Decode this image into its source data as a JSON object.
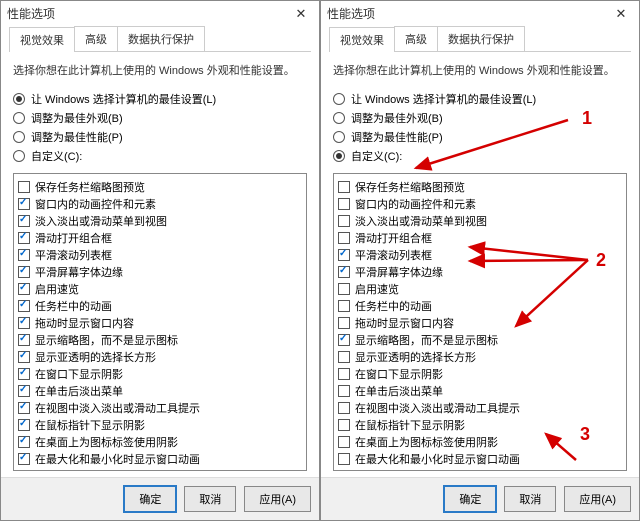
{
  "dialog_title": "性能选项",
  "tabs": {
    "visual": "视觉效果",
    "advanced": "高级",
    "dep": "数据执行保护"
  },
  "desc": "选择你想在此计算机上使用的 Windows 外观和性能设置。",
  "radios": {
    "auto": "让 Windows 选择计算机的最佳设置(L)",
    "best_look": "调整为最佳外观(B)",
    "best_perf": "调整为最佳性能(P)",
    "custom": "自定义(C):"
  },
  "options": [
    "保存任务栏缩略图预览",
    "窗口内的动画控件和元素",
    "淡入淡出或滑动菜单到视图",
    "滑动打开组合框",
    "平滑滚动列表框",
    "平滑屏幕字体边缘",
    "启用速览",
    "任务栏中的动画",
    "拖动时显示窗口内容",
    "显示缩略图，而不是显示图标",
    "显示亚透明的选择长方形",
    "在窗口下显示阴影",
    "在单击后淡出菜单",
    "在视图中淡入淡出或滑动工具提示",
    "在鼠标指针下显示阴影",
    "在桌面上为图标标签使用阴影",
    "在最大化和最小化时显示窗口动画"
  ],
  "left": {
    "selected_radio": "auto",
    "checks": [
      false,
      true,
      true,
      true,
      true,
      true,
      true,
      true,
      true,
      true,
      true,
      true,
      true,
      true,
      true,
      true,
      true
    ]
  },
  "right": {
    "selected_radio": "custom",
    "checks": [
      false,
      false,
      false,
      false,
      true,
      true,
      false,
      false,
      false,
      true,
      false,
      false,
      false,
      false,
      false,
      false,
      false
    ]
  },
  "buttons": {
    "ok": "确定",
    "cancel": "取消",
    "apply": "应用(A)"
  },
  "annotations": {
    "n1": "1",
    "n2": "2",
    "n3": "3"
  }
}
